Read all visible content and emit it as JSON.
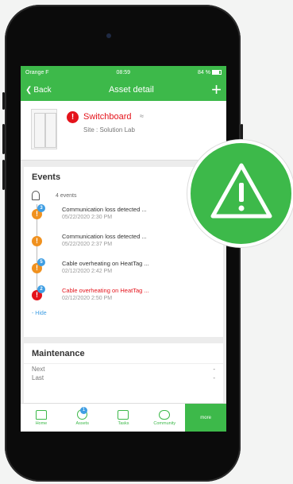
{
  "status_bar": {
    "carrier": "Orange F",
    "time": "08:59",
    "battery": "84 %"
  },
  "nav": {
    "back_label": "Back",
    "title": "Asset detail",
    "add_label": "+"
  },
  "asset": {
    "name": "Switchboard",
    "site": "Site : Solution Lab",
    "alert_glyph": "!"
  },
  "events": {
    "title": "Events",
    "count_label": "4 events",
    "items": [
      {
        "title": "Communication loss detected ...",
        "date": "05/22/2020 2:30 PM",
        "badge": "3",
        "level": "warning",
        "glyph": "!"
      },
      {
        "title": "Communication loss detected ...",
        "date": "05/22/2020 2:37 PM",
        "badge": "",
        "level": "warning",
        "glyph": "!"
      },
      {
        "title": "Cable overheating on HeatTag ...",
        "date": "02/12/2020 2:42 PM",
        "badge": "5",
        "level": "warning",
        "glyph": "!"
      },
      {
        "title": "Cable overheating on HeatTag ...",
        "date": "02/12/2020 2:50 PM",
        "badge": "2",
        "level": "critical",
        "glyph": "!"
      }
    ],
    "hide_label": "- Hide"
  },
  "maintenance": {
    "title": "Maintenance",
    "next_label": "Next",
    "next_value": "-",
    "last_label": "Last",
    "last_value": "-"
  },
  "tabs": [
    {
      "label": "Home",
      "icon": "home-icon"
    },
    {
      "label": "Assets",
      "icon": "assets-icon",
      "badge": "1"
    },
    {
      "label": "Tasks",
      "icon": "tasks-icon"
    },
    {
      "label": "Community",
      "icon": "community-icon"
    },
    {
      "label": "more",
      "icon": "more-icon"
    }
  ],
  "colors": {
    "brand_green": "#3db94a",
    "alert_red": "#e4131b",
    "warning_orange": "#f0911f",
    "badge_blue": "#3f9ee3"
  }
}
